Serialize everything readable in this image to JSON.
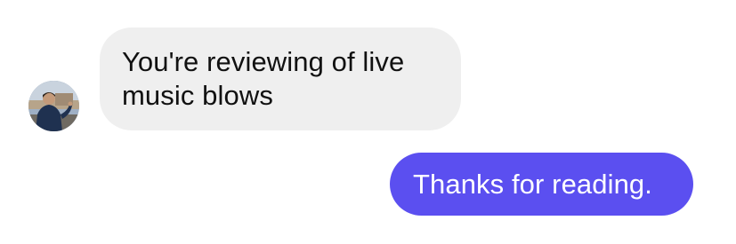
{
  "conversation": {
    "incoming_message": {
      "text": "You're reviewing of live music blows",
      "sender_avatar_icon": "user-avatar-photo"
    },
    "outgoing_message": {
      "text": "Thanks for reading."
    }
  },
  "colors": {
    "background": "#ffffff",
    "incoming_bubble": "#efefef",
    "incoming_text": "#111111",
    "outgoing_bubble": "#5b4ff0",
    "outgoing_text": "#ffffff"
  }
}
